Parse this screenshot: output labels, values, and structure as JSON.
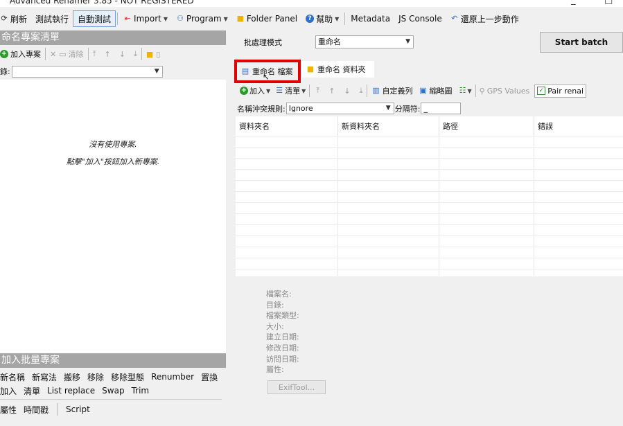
{
  "window": {
    "title": "Advanced Renamer 3.85 - NOT REGISTERED",
    "minimize": "_",
    "maximize": "□"
  },
  "toolbar": {
    "refresh": "刷新",
    "test_run": "測試執行",
    "auto_test": "自動測試",
    "import": "Import",
    "program": "Program",
    "folder_panel": "Folder Panel",
    "help": "幫助",
    "metadata": "Metadata",
    "js_console": "JS Console",
    "undo_last": "還原上一步動作"
  },
  "left_panel": {
    "header": "命名專案清單",
    "add_project": "加入專案",
    "delete": "清除",
    "dir_label": "錄:",
    "empty_line1": "沒有使用專案.",
    "empty_line2": "點擊\"加入\"按鈕加入新專案."
  },
  "batch_panel": {
    "header": "加入批量專案",
    "row1": [
      "新名稱",
      "新寫法",
      "搬移",
      "移除",
      "移除型態",
      "Renumber",
      "置換"
    ],
    "row2": [
      "加入",
      "清單",
      "List replace",
      "Swap",
      "Trim"
    ],
    "row3": [
      "屬性",
      "時間戳",
      "Script"
    ]
  },
  "right_panel": {
    "batch_mode_label": "批處理模式",
    "batch_mode_value": "重命名",
    "start_batch": "Start batch",
    "tabs": [
      {
        "label": "重命名 檔案",
        "selected": false,
        "highlighted": true
      },
      {
        "label": "重命名 資料夾",
        "selected": true,
        "highlighted": false
      }
    ],
    "add": "加入",
    "list": "清單",
    "custom_columns": "自定義列",
    "thumbnails": "縮略圖",
    "gps_values": "GPS Values",
    "pair_rename": "Pair renai",
    "conflict_label": "名稱沖突規則:",
    "conflict_value": "Ignore",
    "separator_label": "分隔符:",
    "separator_value": "_",
    "columns": [
      "資料夾名",
      "新資料夾名",
      "路徑",
      "錯誤"
    ],
    "info_fields": [
      "檔案名:",
      "目錄:",
      "檔案類型:",
      "大小:",
      "建立日期:",
      "修改日期:",
      "訪問日期:",
      "屬性:"
    ],
    "exiftool": "ExifTool..."
  },
  "colors": {
    "highlight": "#e00000",
    "panel_header": "#a5a5a5",
    "folder": "#f0b400",
    "accent_blue": "#2e6fcf",
    "green": "#2a9a2a"
  }
}
